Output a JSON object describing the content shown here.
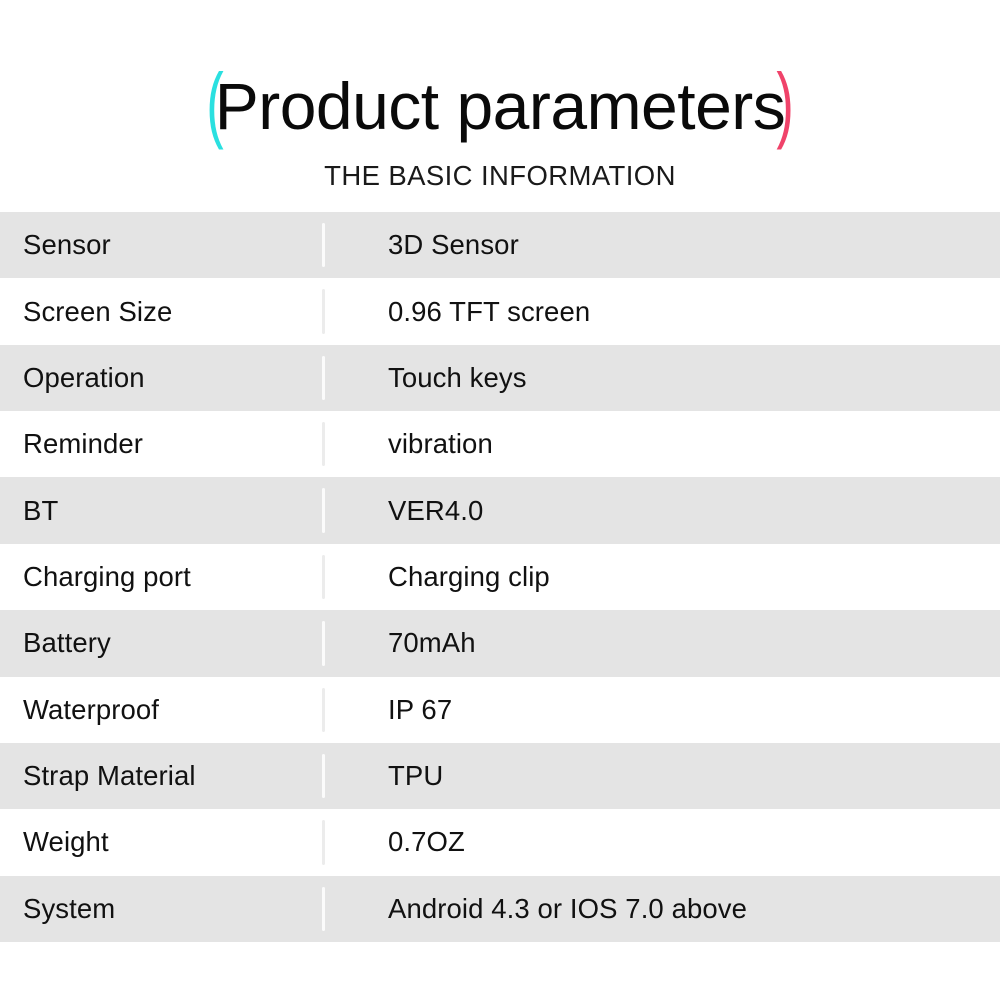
{
  "header": {
    "bracket_left": "(",
    "bracket_right": ")",
    "bracket_left_color": "#2ae0e0",
    "bracket_right_color": "#f0436a",
    "title": "Product parameters",
    "subtitle": "THE BASIC INFORMATION"
  },
  "table": {
    "row_shade_color": "#e4e4e4",
    "row_plain_color": "#ffffff",
    "rows": [
      {
        "label": "Sensor",
        "value": "3D Sensor"
      },
      {
        "label": "Screen Size",
        "value": "0.96 TFT screen"
      },
      {
        "label": "Operation",
        "value": "Touch keys"
      },
      {
        "label": "Reminder",
        "value": "vibration"
      },
      {
        "label": "BT",
        "value": "VER4.0"
      },
      {
        "label": "Charging port",
        "value": "Charging clip"
      },
      {
        "label": "Battery",
        "value": "70mAh"
      },
      {
        "label": "Waterproof",
        "value": "IP 67"
      },
      {
        "label": "Strap Material",
        "value": "TPU"
      },
      {
        "label": "Weight",
        "value": "0.7OZ"
      },
      {
        "label": "System",
        "value": "Android 4.3 or IOS 7.0 above"
      }
    ]
  }
}
